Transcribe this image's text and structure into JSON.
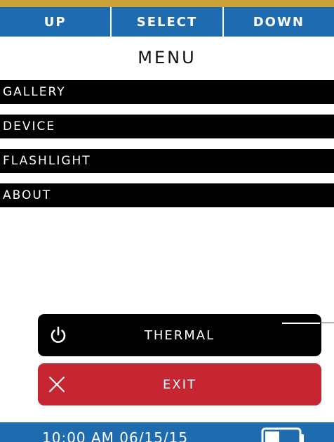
{
  "nav": {
    "up_label": "UP",
    "select_label": "SELECT",
    "down_label": "DOWN"
  },
  "menu": {
    "title": "MENU",
    "items": [
      {
        "label": "GALLERY"
      },
      {
        "label": "DEVICE"
      },
      {
        "label": "FLASHLIGHT"
      },
      {
        "label": "ABOUT"
      }
    ]
  },
  "actions": {
    "thermal_label": "THERMAL",
    "thermal_icon": "power-icon",
    "exit_label": "EXIT",
    "exit_icon": "close-icon"
  },
  "status": {
    "datetime": "10:00 AM 06/15/15",
    "battery_icon": "battery-icon"
  },
  "colors": {
    "nav_blue": "#1f6bb0",
    "exit_red": "#c62631",
    "menu_black": "#000000",
    "top_strip": "#c9a23a"
  }
}
